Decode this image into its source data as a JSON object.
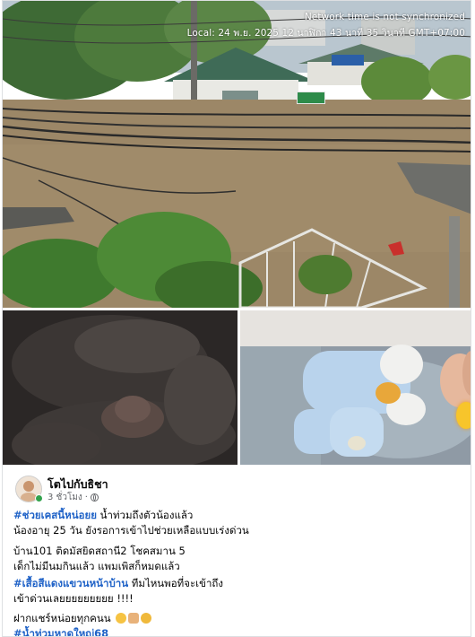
{
  "photo_top": {
    "overlay_line1": "Network time is not synchronized",
    "overlay_line2": "Local: 24 พ.ย. 2025 12 นาฬิกา 43 นาที 35 วินาที GMT+07:00",
    "sign_text": "",
    "shop_sign_text": ""
  },
  "post": {
    "author": "โตไปกับธิชา",
    "time": "3 ชั่วโมง",
    "line1_tag": "#ช่วยเคสนี้หน่อยย",
    "line1_text": " น้ำท่วมถึงตัวน้องแล้ว",
    "line2": "น้องอายุ 25 วัน ยังรอการเข้าไปช่วยเหลือแบบเร่งด่วน",
    "line3": "บ้าน101 ติดมัสยิดสถานี2 โชคสมาน 5",
    "line4": "เด็กไม่มีนมกินแล้ว  แพมเพิสก็หมดแล้ว",
    "line5_tag": "#เสื้อสีแดงแขวนหน้าบ้าน",
    "line5_text": " ทีมไหนพอที่จะเข้าถึง",
    "line6": "เข้าด่วนเลยยยยยยยยย !!!!",
    "line7": "ฝากแชร์หน่อยทุกคนน",
    "line8_tag": "#น้ำท่วมหาดใหญ่68"
  },
  "icons": {
    "globe": "globe-icon",
    "sad": "sad-face-emoji",
    "pray": "folded-hands-emoji",
    "cry": "crying-face-emoji"
  },
  "colors": {
    "hashtag": "#1f62c7",
    "flood_water": "#9c8767",
    "online_dot": "#31a24c"
  }
}
